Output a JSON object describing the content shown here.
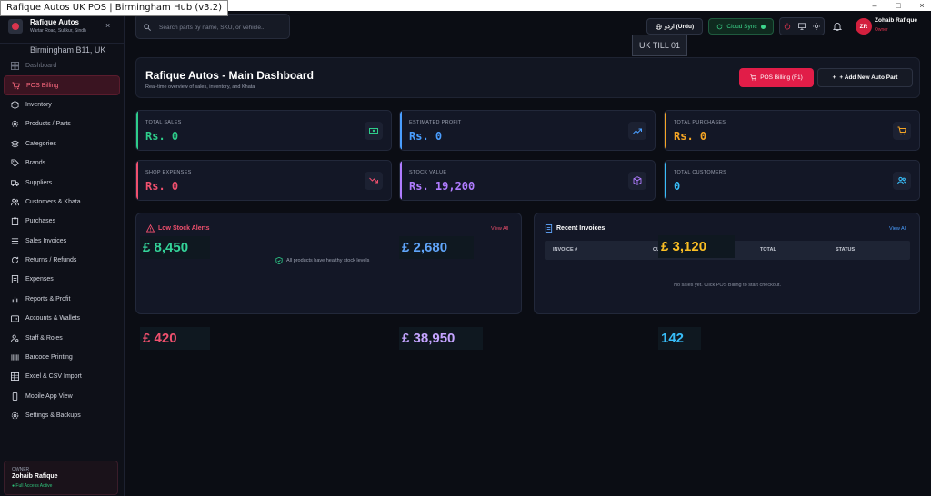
{
  "window": {
    "title": "Rafique Autos UK POS | Birmingham Hub (v3.2)",
    "controls": [
      "–",
      "□",
      "×"
    ]
  },
  "brand": {
    "name": "Rafique Autos",
    "address": "Wartar Road, Sukkur, Sindh",
    "close": "×"
  },
  "location_tooltip": "Birmingham B11, UK",
  "till_tooltip": "UK TILL 01",
  "sidebar": {
    "items": [
      {
        "label": "Dashboard",
        "icon": "grid-icon"
      },
      {
        "label": "POS Billing",
        "icon": "cart-icon"
      },
      {
        "label": "Inventory",
        "icon": "box-icon"
      },
      {
        "label": "Products / Parts",
        "icon": "gear-icon"
      },
      {
        "label": "Categories",
        "icon": "layers-icon"
      },
      {
        "label": "Brands",
        "icon": "tag-icon"
      },
      {
        "label": "Suppliers",
        "icon": "truck-icon"
      },
      {
        "label": "Customers & Khata",
        "icon": "users-icon"
      },
      {
        "label": "Purchases",
        "icon": "clipboard-icon"
      },
      {
        "label": "Sales Invoices",
        "icon": "receipt-icon"
      },
      {
        "label": "Returns / Refunds",
        "icon": "refresh-icon"
      },
      {
        "label": "Expenses",
        "icon": "file-icon"
      },
      {
        "label": "Reports & Profit",
        "icon": "bar-chart-icon"
      },
      {
        "label": "Accounts & Wallets",
        "icon": "wallet-icon"
      },
      {
        "label": "Staff & Roles",
        "icon": "user-cog-icon"
      },
      {
        "label": "Barcode Printing",
        "icon": "barcode-icon"
      },
      {
        "label": "Excel & CSV Import",
        "icon": "table-icon"
      },
      {
        "label": "Mobile App View",
        "icon": "phone-icon"
      },
      {
        "label": "Settings & Backups",
        "icon": "settings-icon"
      }
    ],
    "active_index": 1
  },
  "owner": {
    "role": "OWNER",
    "name": "Zohaib Rafique",
    "status": "● Full Access Active"
  },
  "header": {
    "search_placeholder": "Search parts by name, SKU, or vehicle...",
    "language": "اردو (Urdu)",
    "cloud": "Cloud Sync",
    "user_name": "Zohaib Rafique",
    "user_role": "Owner",
    "avatar_initials": "ZR"
  },
  "dashboard": {
    "title": "Rafique Autos - Main Dashboard",
    "subtitle": "Real-time overview of sales, inventory, and Khata",
    "pos_button": "POS Billing (F1)",
    "add_button": "+ Add New Auto Part"
  },
  "stats": [
    {
      "label": "TOTAL SALES",
      "value": "Rs. 0",
      "color": "#2ecc8a",
      "icon": "cash-icon"
    },
    {
      "label": "ESTIMATED PROFIT",
      "value": "Rs. 0",
      "color": "#4a9eff",
      "icon": "trending-up-icon"
    },
    {
      "label": "TOTAL PURCHASES",
      "value": "Rs. 0",
      "color": "#f5a524",
      "icon": "cart-icon"
    },
    {
      "label": "SHOP EXPENSES",
      "value": "Rs. 0",
      "color": "#f0506e",
      "icon": "trending-down-icon"
    },
    {
      "label": "STOCK VALUE",
      "value": "Rs. 19,200",
      "color": "#b07cff",
      "icon": "cube-icon"
    },
    {
      "label": "TOTAL CUSTOMERS",
      "value": "0",
      "color": "#38bdf8",
      "icon": "users-icon"
    }
  ],
  "low_stock": {
    "title": "Low Stock Alerts",
    "link": "View All",
    "message": "All products have healthy stock levels"
  },
  "recent_invoices": {
    "title": "Recent Invoices",
    "link": "View All",
    "columns": [
      "INVOICE #",
      "CU",
      "TOTAL",
      "STATUS"
    ],
    "empty": "No sales yet. Click POS Billing to start checkout."
  },
  "gbp_overlays": [
    {
      "text": "£ 8,450",
      "color": "#34d399"
    },
    {
      "text": "£ 2,680",
      "color": "#60a5fa"
    },
    {
      "text": "£ 3,120",
      "color": "#fbbf24"
    },
    {
      "text": "£ 420",
      "color": "#f0506e"
    },
    {
      "text": "£ 38,950",
      "color": "#c4a4ff"
    },
    {
      "text": "142",
      "color": "#38bdf8"
    }
  ]
}
